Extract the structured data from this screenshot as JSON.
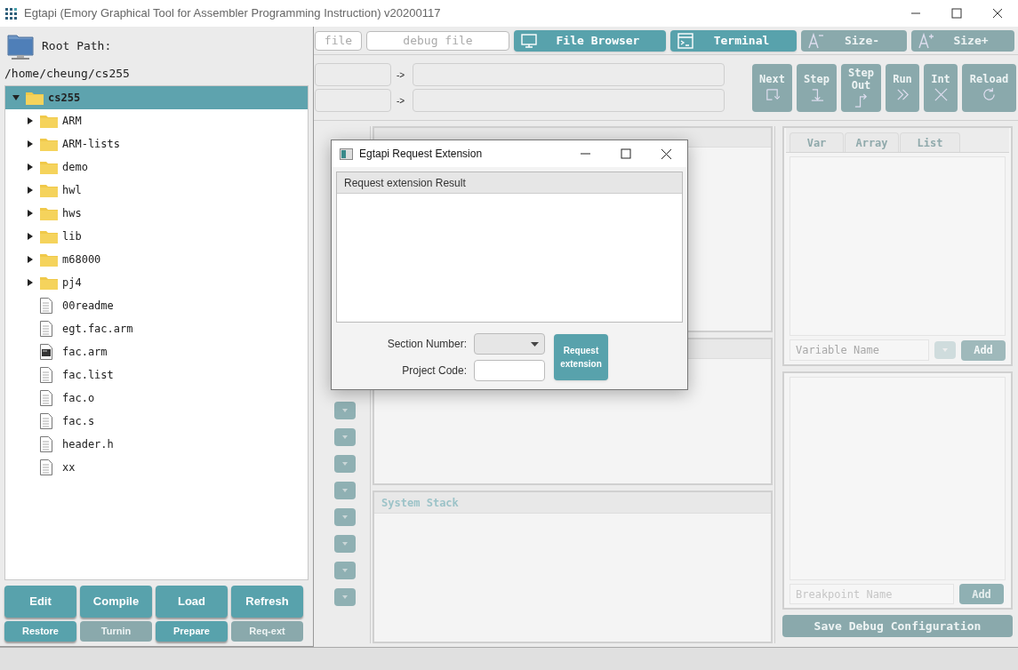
{
  "window": {
    "title": "Egtapi (Emory Graphical Tool for Assembler Programming Instruction) v20200117"
  },
  "toolbar": {
    "fields": [
      {
        "placeholder": "file"
      },
      {
        "placeholder": "debug file"
      }
    ],
    "buttons": [
      {
        "label": "File Browser",
        "disabled": false
      },
      {
        "label": "Terminal",
        "disabled": false
      },
      {
        "label": "Size-",
        "disabled": true
      },
      {
        "label": "Size+",
        "disabled": true
      }
    ]
  },
  "mapping_rows": [
    {
      "arrow": "->"
    },
    {
      "arrow": "->"
    }
  ],
  "debug_buttons": [
    {
      "label": "Next",
      "disabled": true
    },
    {
      "label": "Step",
      "disabled": true
    },
    {
      "label": "Step Out",
      "disabled": true
    },
    {
      "label": "Run",
      "disabled": true
    },
    {
      "label": "Int",
      "disabled": true
    },
    {
      "label": "Reload",
      "disabled": true
    }
  ],
  "system_stack": {
    "title": "System Stack"
  },
  "watch": {
    "tabs": [
      {
        "label": "Var"
      },
      {
        "label": "Array"
      },
      {
        "label": "List"
      }
    ],
    "field": {
      "placeholder": "Variable Name"
    },
    "add": "Add"
  },
  "breakpoints": {
    "field": {
      "placeholder": "Breakpoint Name"
    },
    "add": "Add"
  },
  "save_button": {
    "label": "Save Debug Configuration",
    "disabled": true
  },
  "file_browser": {
    "title": "Root Path:",
    "path": "/home/cheung/cs255",
    "tree": [
      {
        "label": "cs255",
        "kind": "folder",
        "expanded": true,
        "selected": true,
        "children": [
          {
            "label": "ARM",
            "kind": "folder",
            "expanded": false,
            "selected": false
          },
          {
            "label": "ARM-lists",
            "kind": "folder",
            "expanded": false,
            "selected": false
          },
          {
            "label": "demo",
            "kind": "folder",
            "expanded": false,
            "selected": false
          },
          {
            "label": "hwl",
            "kind": "folder",
            "expanded": false,
            "selected": false
          },
          {
            "label": "hws",
            "kind": "folder",
            "expanded": false,
            "selected": false
          },
          {
            "label": "lib",
            "kind": "folder",
            "expanded": false,
            "selected": false
          },
          {
            "label": "m68000",
            "kind": "folder",
            "expanded": false,
            "selected": false
          },
          {
            "label": "pj4",
            "kind": "folder",
            "expanded": false,
            "selected": false
          },
          {
            "label": "00readme",
            "kind": "file",
            "selected": false
          },
          {
            "label": "egt.fac.arm",
            "kind": "file",
            "selected": false
          },
          {
            "label": "fac.arm",
            "kind": "executable",
            "selected": false
          },
          {
            "label": "fac.list",
            "kind": "file",
            "selected": false
          },
          {
            "label": "fac.o",
            "kind": "file",
            "selected": false
          },
          {
            "label": "fac.s",
            "kind": "file",
            "selected": false
          },
          {
            "label": "header.h",
            "kind": "file",
            "selected": false
          },
          {
            "label": "xx",
            "kind": "file",
            "selected": false
          }
        ]
      }
    ],
    "buttons": [
      {
        "label": "Edit",
        "disabled": false
      },
      {
        "label": "Compile",
        "disabled": false
      },
      {
        "label": "Load",
        "disabled": false
      },
      {
        "label": "Refresh",
        "disabled": false
      }
    ],
    "small_buttons": [
      {
        "label": "Restore",
        "disabled": false
      },
      {
        "label": "Turnin",
        "disabled": true
      },
      {
        "label": "Prepare",
        "disabled": false
      },
      {
        "label": "Req-ext",
        "disabled": true
      }
    ]
  },
  "dialog": {
    "title": "Egtapi Request Extension",
    "result_header": "Request extension Result",
    "section_label": "Section Number:",
    "project_label": "Project Code:",
    "submit": "Request extension"
  }
}
